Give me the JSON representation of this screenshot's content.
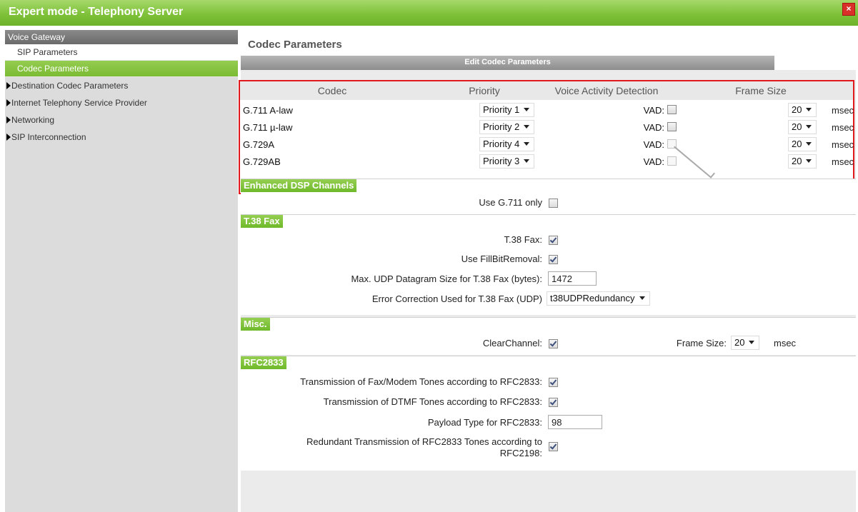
{
  "window": {
    "title": "Expert mode - Telephony Server",
    "close_label": "×"
  },
  "sidebar": {
    "header": "Voice Gateway",
    "sub_items": [
      {
        "label": "SIP Parameters",
        "active": false
      },
      {
        "label": "Codec Parameters",
        "active": true
      }
    ],
    "items": [
      {
        "label": "Destination Codec Parameters"
      },
      {
        "label": "Internet Telephony Service Provider"
      },
      {
        "label": "Networking"
      },
      {
        "label": "SIP Interconnection"
      }
    ]
  },
  "main": {
    "title": "Codec Parameters",
    "edit_header": "Edit Codec Parameters",
    "codec_table": {
      "headers": [
        "Codec",
        "Priority",
        "Voice Activity Detection",
        "Frame Size"
      ],
      "rows": [
        {
          "codec": "G.711 A-law",
          "priority": "Priority 1",
          "vad_label": "VAD:",
          "vad_checked": false,
          "vad_disabled": false,
          "frame_size": "20",
          "unit": "msec"
        },
        {
          "codec": "G.711 µ-law",
          "priority": "Priority 2",
          "vad_label": "VAD:",
          "vad_checked": false,
          "vad_disabled": false,
          "frame_size": "20",
          "unit": "msec"
        },
        {
          "codec": "G.729A",
          "priority": "Priority 4",
          "vad_label": "VAD:",
          "vad_checked": false,
          "vad_disabled": true,
          "frame_size": "20",
          "unit": "msec"
        },
        {
          "codec": "G.729AB",
          "priority": "Priority 3",
          "vad_label": "VAD:",
          "vad_checked": true,
          "vad_disabled": true,
          "frame_size": "20",
          "unit": "msec"
        }
      ]
    },
    "enhanced_dsp": {
      "header": "Enhanced DSP Channels",
      "use_g711_label": "Use G.711 only",
      "use_g711_checked": false
    },
    "t38": {
      "header": "T.38 Fax",
      "t38_fax_label": "T.38 Fax:",
      "t38_fax_checked": true,
      "fillbit_label": "Use FillBitRemoval:",
      "fillbit_checked": true,
      "udp_size_label": "Max. UDP Datagram Size for T.38 Fax (bytes):",
      "udp_size_value": "1472",
      "error_corr_label": "Error Correction Used for T.38 Fax (UDP)",
      "error_corr_value": "t38UDPRedundancy"
    },
    "misc": {
      "header": "Misc.",
      "clearchannel_label": "ClearChannel:",
      "clearchannel_checked": true,
      "frame_size_label": "Frame Size:",
      "frame_size_value": "20",
      "unit": "msec"
    },
    "rfc2833": {
      "header": "RFC2833",
      "fax_modem_label": "Transmission of Fax/Modem Tones according to RFC2833:",
      "fax_modem_checked": true,
      "dtmf_label": "Transmission of DTMF Tones according to RFC2833:",
      "dtmf_checked": true,
      "payload_label": "Payload Type for RFC2833:",
      "payload_value": "98",
      "redundant_label_1": "Redundant Transmission of RFC2833 Tones according to",
      "redundant_label_2": "RFC2198:",
      "redundant_checked": true
    }
  },
  "colors": {
    "accent_green": "#7fc23a",
    "close_red": "#d9302a",
    "highlight_border": "#e0191f"
  }
}
